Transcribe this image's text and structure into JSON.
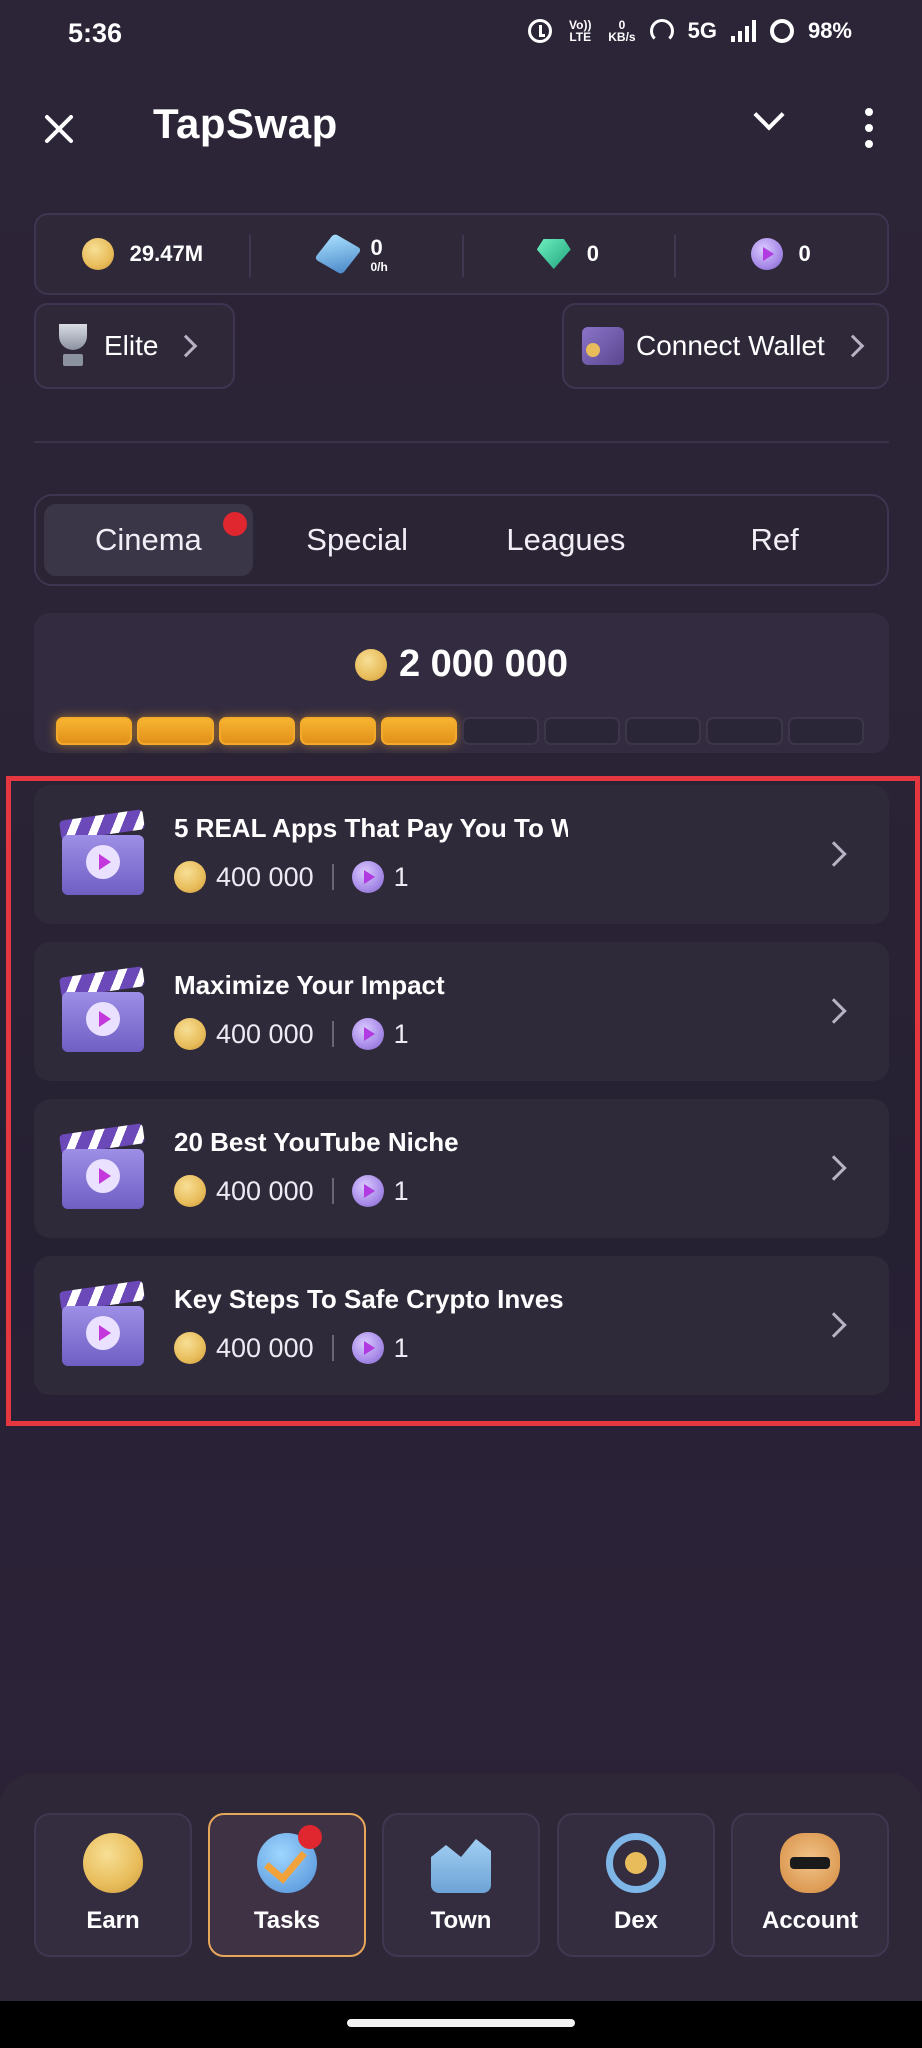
{
  "status_bar": {
    "time": "5:36",
    "volte": "Vo)) LTE",
    "net_speed_value": "0",
    "net_speed_unit": "KB/s",
    "network": "5G",
    "battery": "98%"
  },
  "header": {
    "title": "TapSwap"
  },
  "balances": {
    "coins": "29.47M",
    "cubes": "0",
    "cubes_rate": "0/h",
    "gems": "0",
    "tickets": "0"
  },
  "league": {
    "label": "Elite"
  },
  "wallet": {
    "label": "Connect Wallet"
  },
  "tabs": [
    {
      "label": "Cinema",
      "active": true,
      "badge": true
    },
    {
      "label": "Special",
      "active": false
    },
    {
      "label": "Leagues",
      "active": false
    },
    {
      "label": "Ref",
      "active": false
    }
  ],
  "reward": {
    "amount": "2 000 000",
    "progress_filled": 5,
    "progress_total": 10
  },
  "tasks": [
    {
      "title": "5 REAL Apps That Pay You To W",
      "coins": "400 000",
      "tickets": "1"
    },
    {
      "title": "Maximize Your Impact",
      "coins": "400 000",
      "tickets": "1"
    },
    {
      "title": "20 Best YouTube Niche",
      "coins": "400 000",
      "tickets": "1"
    },
    {
      "title": "Key Steps To Safe Crypto Inves",
      "coins": "400 000",
      "tickets": "1"
    }
  ],
  "bottom_nav": [
    {
      "label": "Earn",
      "icon": "coin-icon",
      "active": false
    },
    {
      "label": "Tasks",
      "icon": "check-icon",
      "active": true
    },
    {
      "label": "Town",
      "icon": "town-icon",
      "active": false
    },
    {
      "label": "Dex",
      "icon": "exchange-icon",
      "active": false
    },
    {
      "label": "Account",
      "icon": "cat-avatar-icon",
      "active": false
    }
  ],
  "colors": {
    "accent_orange": "#f3aa2a",
    "badge_red": "#e0262f",
    "highlight_frame": "#e5373f"
  }
}
